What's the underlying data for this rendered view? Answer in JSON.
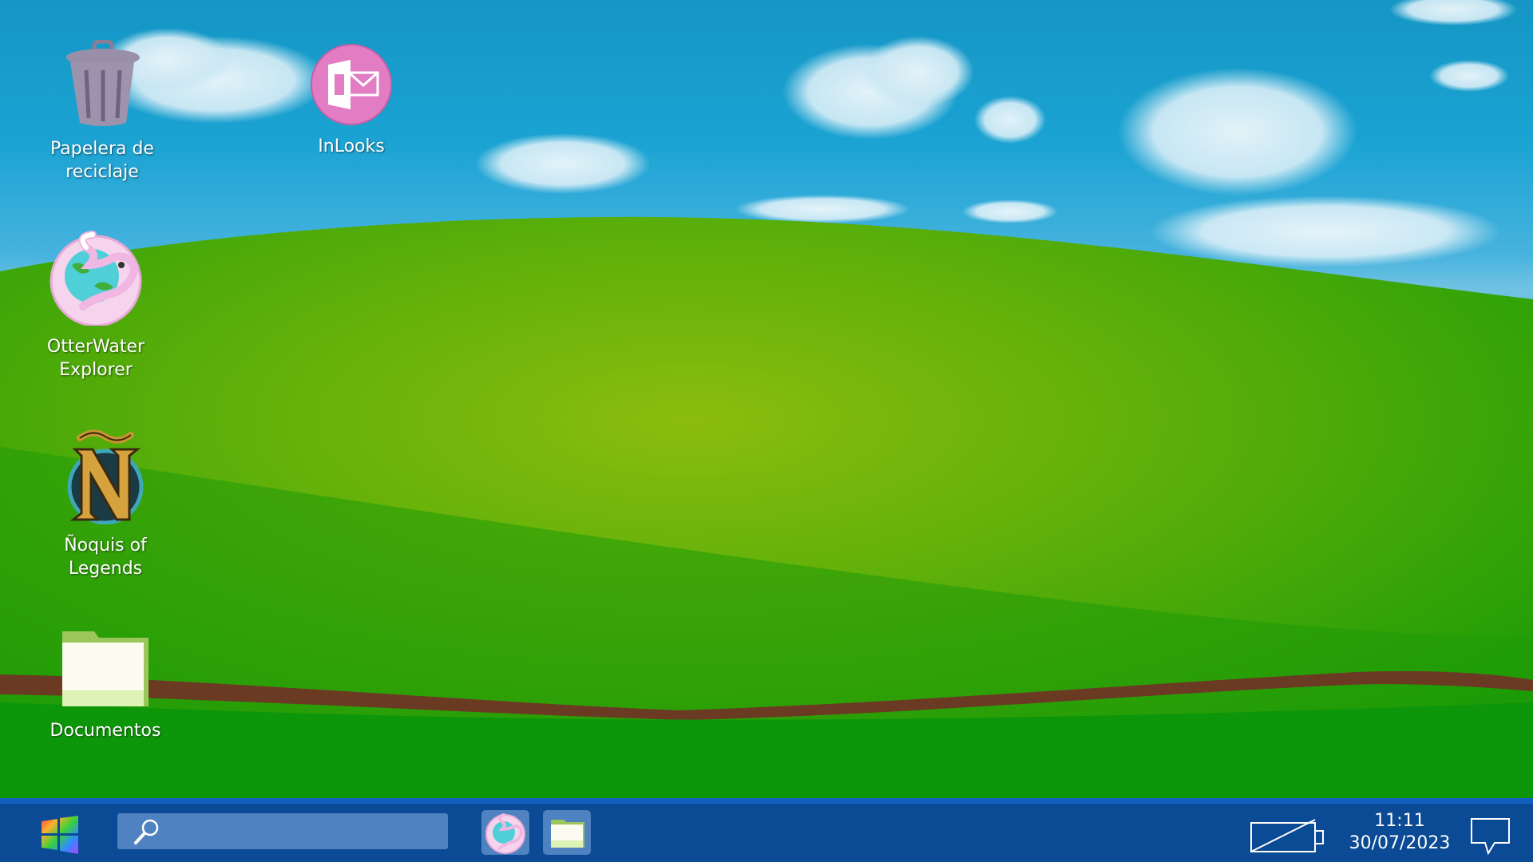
{
  "desktop": {
    "wallpaper": "Hills under blue sky",
    "icons": [
      {
        "label": "Papelera de reciclaje",
        "icon": "recycle-bin-icon"
      },
      {
        "label": "InLooks",
        "icon": "mail-app-icon"
      },
      {
        "label": "OtterWater Explorer",
        "icon": "otterwater-explorer-icon"
      },
      {
        "label": "Ñoquis of Legends",
        "icon": "noquis-of-legends-icon"
      },
      {
        "label": "Documentos",
        "icon": "folder-icon"
      }
    ]
  },
  "taskbar": {
    "start_icon": "windows-logo-icon",
    "search_icon": "search-icon",
    "pinned": [
      {
        "icon": "otterwater-explorer-icon"
      },
      {
        "icon": "folder-icon"
      }
    ],
    "battery_icon": "battery-icon",
    "time": "11:11",
    "date": "30/07/2023",
    "notifications_icon": "notification-icon"
  },
  "colors": {
    "taskbar": "#0b4a94",
    "taskbar_border": "#1460c0",
    "search_box": "#4f82c0",
    "sky": "#1ba3d3",
    "grass": "#2e9a0a"
  }
}
